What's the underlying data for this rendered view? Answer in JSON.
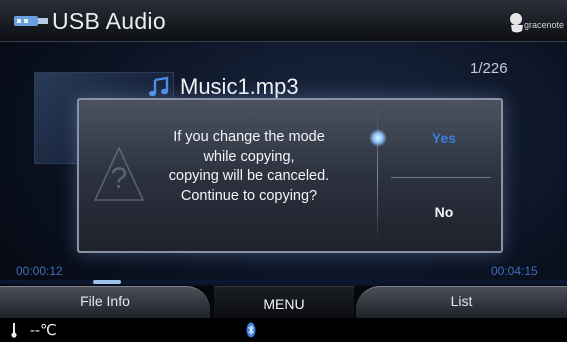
{
  "app": {
    "title": "USB Audio",
    "logo_label": "gracenote"
  },
  "track": {
    "title": "Music1.mp3",
    "count": "1/226"
  },
  "dialog": {
    "message_lines": [
      "If you change the mode",
      "while copying,",
      "copying will be canceled.",
      "Continue to copying?"
    ],
    "options": {
      "yes": "Yes",
      "no": "No"
    },
    "selected": "Yes"
  },
  "progress": {
    "elapsed": "00:00:12",
    "total": "00:04:15",
    "fraction": 0.05
  },
  "tabs": {
    "file_info": "File Info",
    "menu": "MENU",
    "list": "List"
  },
  "status": {
    "temperature": "--℃"
  },
  "icons": [
    "usb-icon",
    "gracenote-logo-icon",
    "music-note-icon",
    "help-question-icon",
    "thermometer-icon",
    "bluetooth-icon"
  ],
  "colors": {
    "selected_option": "#3e7de0",
    "time_text": "#3d6fb8",
    "progress_fill": "#9cc2ee"
  }
}
